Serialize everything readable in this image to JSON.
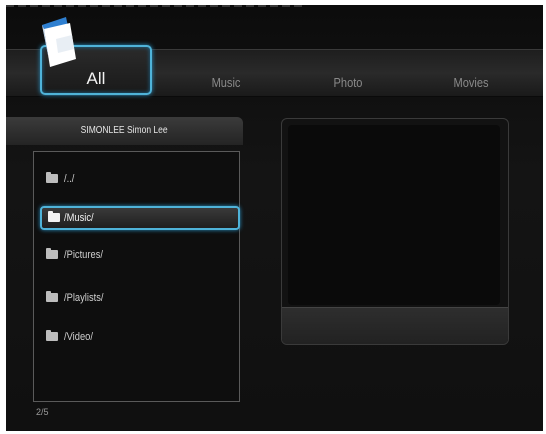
{
  "tabs": {
    "all": "All",
    "music": "Music",
    "photo": "Photo",
    "movies": "Movies"
  },
  "browser": {
    "source_title": "SIMONLEE Simon Lee",
    "items": [
      {
        "label": "/../",
        "selected": false
      },
      {
        "label": "/Music/",
        "selected": true
      },
      {
        "label": "/Pictures/",
        "selected": false
      },
      {
        "label": "/Playlists/",
        "selected": false
      },
      {
        "label": "/Video/",
        "selected": false
      }
    ],
    "position": "2/5"
  },
  "colors": {
    "accent": "#4fb3d9",
    "background": "#101010"
  },
  "icons": {
    "logo": "blue-book-icon",
    "folder": "folder-icon"
  }
}
